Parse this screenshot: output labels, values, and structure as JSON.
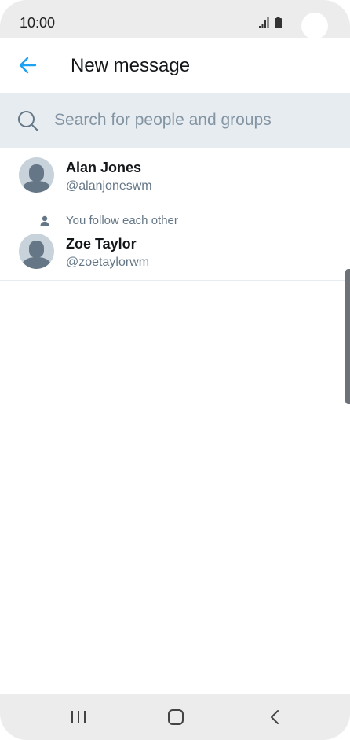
{
  "status_bar": {
    "time": "10:00",
    "icons": [
      "signal-icon",
      "battery-icon"
    ]
  },
  "header": {
    "back_icon": "arrow-left-icon",
    "title": "New message",
    "accent_color": "#1da1f2"
  },
  "search": {
    "icon": "search-icon",
    "placeholder": "Search for people and groups",
    "value": ""
  },
  "contacts": [
    {
      "name": "Alan Jones",
      "handle": "@alanjoneswm",
      "context": ""
    },
    {
      "name": "Zoe Taylor",
      "handle": "@zoetaylorwm",
      "context": "You follow each other"
    }
  ],
  "nav_bar": {
    "buttons": [
      "recent-apps-icon",
      "home-icon",
      "back-icon"
    ]
  }
}
